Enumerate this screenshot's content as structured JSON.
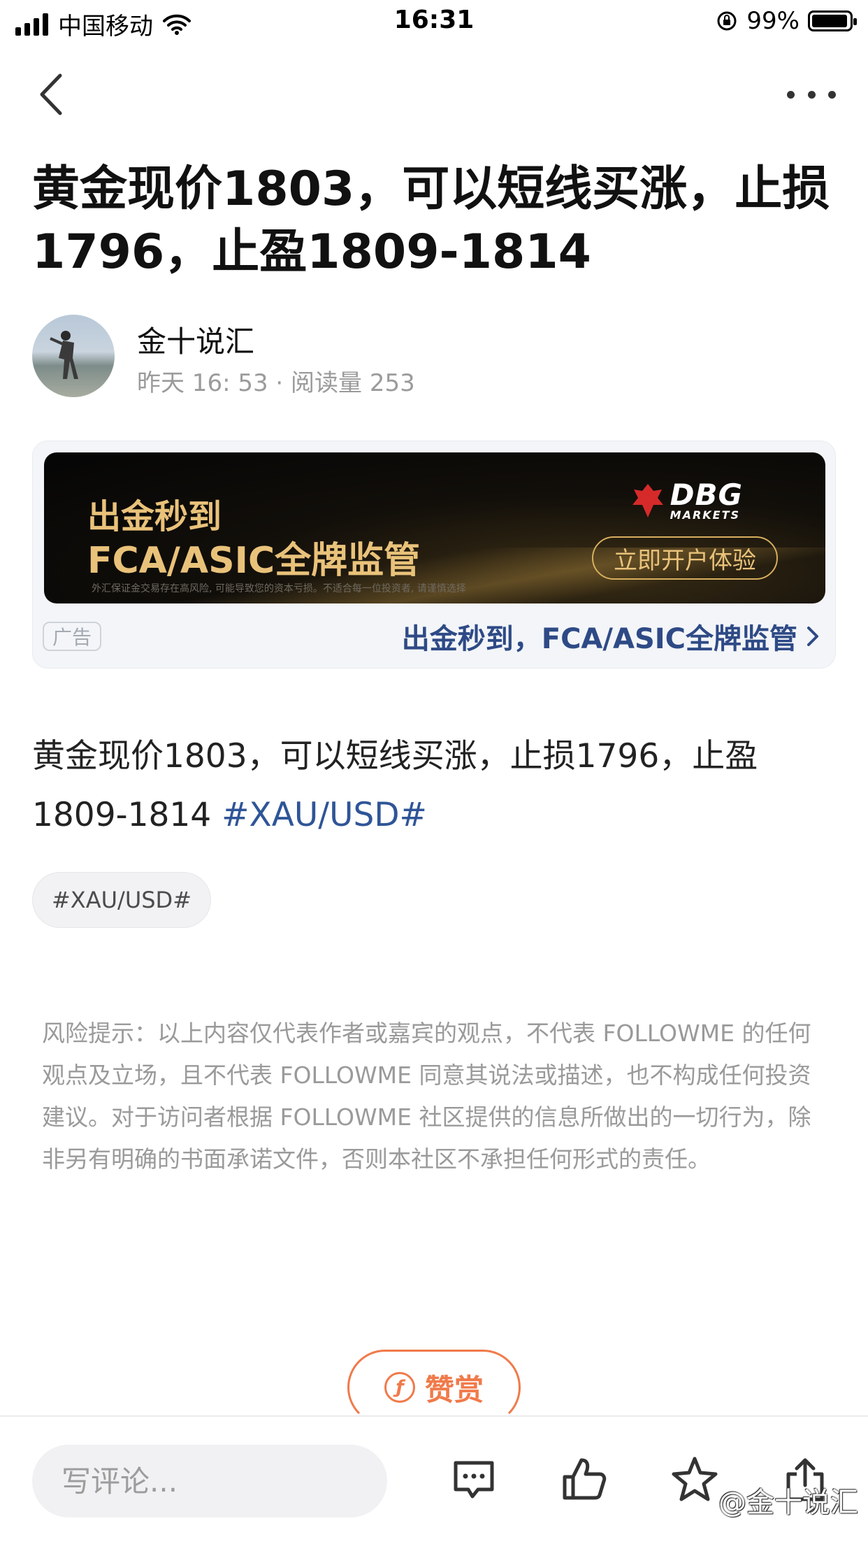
{
  "status_bar": {
    "carrier": "中国移动",
    "time": "16:31",
    "battery": "99%",
    "battery_level": 0.99
  },
  "nav": {
    "back_icon": "chevron-left-icon",
    "more_icon": "more-horizontal-icon"
  },
  "article": {
    "title": "黄金现价1803，可以短线买涨，止损1796，止盈1809-1814",
    "author": "金十说汇",
    "meta": "昨天 16: 53 · 阅读量 253",
    "body_text": "黄金现价1803，可以短线买涨，止损1796，止盈1809-1814 ",
    "body_hashtag": "#XAU/USD#",
    "tag": "#XAU/USD#"
  },
  "ad": {
    "line1": "出金秒到",
    "line2": "FCA/ASIC全牌监管",
    "fine_print": "外汇保证金交易存在高风险, 可能导致您的资本亏损。不适合每一位投资者, 请谨慎选择",
    "logo_big": "DBG",
    "logo_small": "MARKETS",
    "cta": "立即开户体验",
    "tag": "广告",
    "link_text": "出金秒到，FCA/ASIC全牌监管"
  },
  "risk_notice": "风险提示：以上内容仅代表作者或嘉宾的观点，不代表 FOLLOWME 的任何观点及立场，且不代表 FOLLOWME 同意其说法或描述，也不构成任何投资建议。对于访问者根据 FOLLOWME 社区提供的信息所做出的一切行为，除非另有明确的书面承诺文件，否则本社区不承担任何形式的责任。",
  "reward": {
    "label": "赞赏"
  },
  "bottom_bar": {
    "comment_placeholder": "写评论...",
    "icons": [
      "comment-icon",
      "like-icon",
      "star-icon",
      "share-icon"
    ],
    "watermark": "@金十说汇"
  },
  "colors": {
    "accent_link": "#2f5597",
    "reward_orange": "#f07a4a",
    "ad_gold": "#e9c27a"
  }
}
